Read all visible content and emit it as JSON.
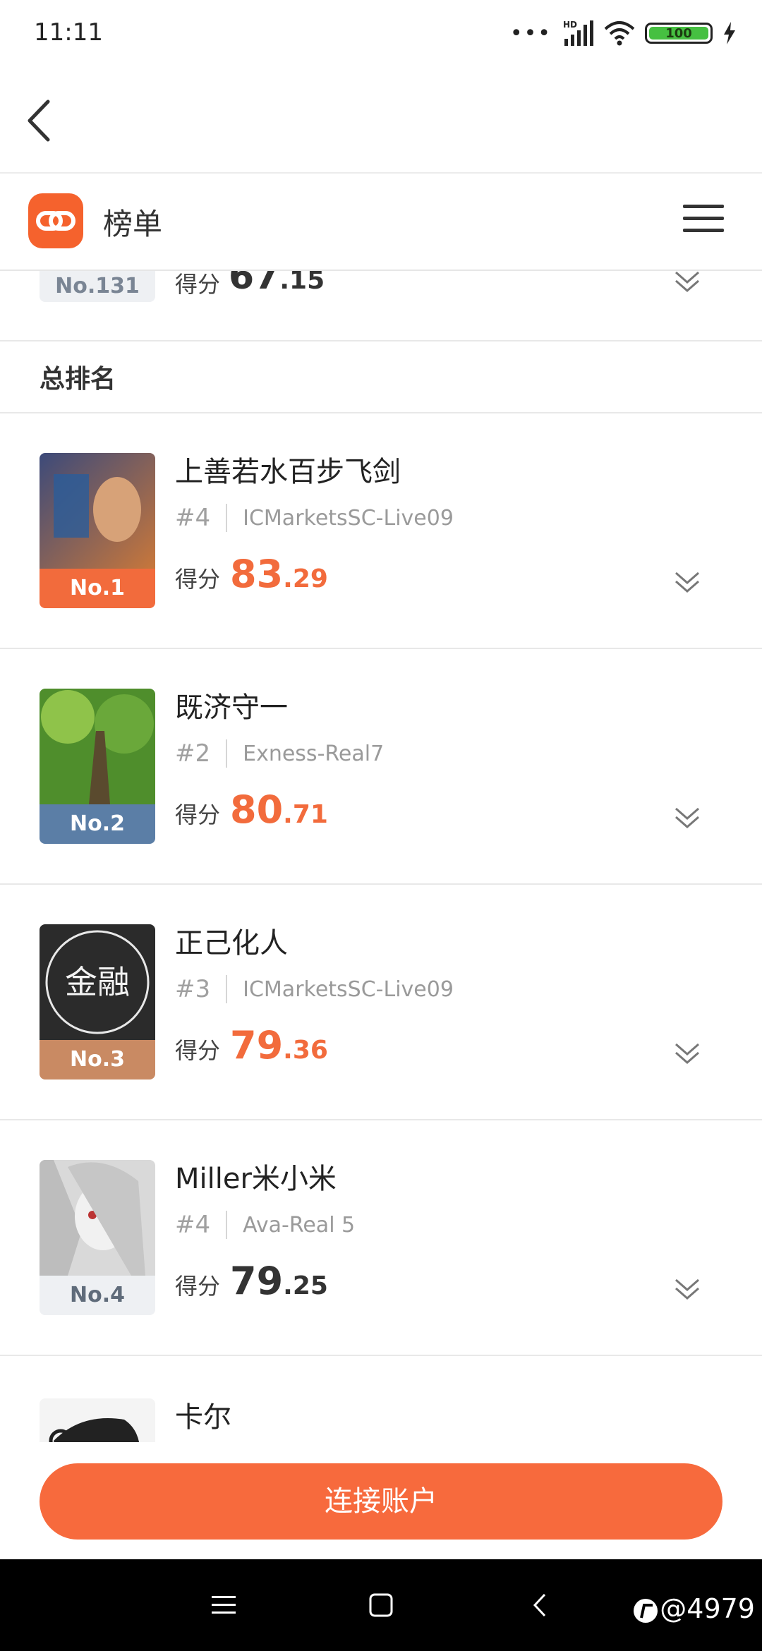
{
  "status_bar": {
    "time": "11:11",
    "battery": "100",
    "network": "HD"
  },
  "header": {
    "title": "榜单"
  },
  "previous_entry": {
    "rank_badge": "No.131",
    "score_label": "得分",
    "score_int": "67",
    "score_dec": ".15"
  },
  "section": {
    "title": "总排名"
  },
  "entries": [
    {
      "name": "上善若水百步飞剑",
      "rank_tag": "#4",
      "server": "ICMarketsSC-Live09",
      "score_label": "得分",
      "score_int": "83",
      "score_dec": ".29",
      "badge": "No.1",
      "badge_color": "#f26b3c",
      "score_color": "#f26b3c"
    },
    {
      "name": "既济守一",
      "rank_tag": "#2",
      "server": "Exness-Real7",
      "score_label": "得分",
      "score_int": "80",
      "score_dec": ".71",
      "badge": "No.2",
      "badge_color": "#5b7ea6",
      "score_color": "#f26b3c"
    },
    {
      "name": "正己化人",
      "rank_tag": "#3",
      "server": "ICMarketsSC-Live09",
      "score_label": "得分",
      "score_int": "79",
      "score_dec": ".36",
      "badge": "No.3",
      "badge_color": "#c98a63",
      "score_color": "#f26b3c",
      "avatar_text": "金融"
    },
    {
      "name": "Miller米小米",
      "rank_tag": "#4",
      "server": "Ava-Real 5",
      "score_label": "得分",
      "score_int": "79",
      "score_dec": ".25",
      "badge": "No.4",
      "badge_color": "#eef0f3",
      "score_color": "#333333"
    },
    {
      "name": "卡尔"
    }
  ],
  "action": {
    "connect_label": "连接账户"
  },
  "watermark": "@4979",
  "colors": {
    "accent": "#f76a3d"
  }
}
